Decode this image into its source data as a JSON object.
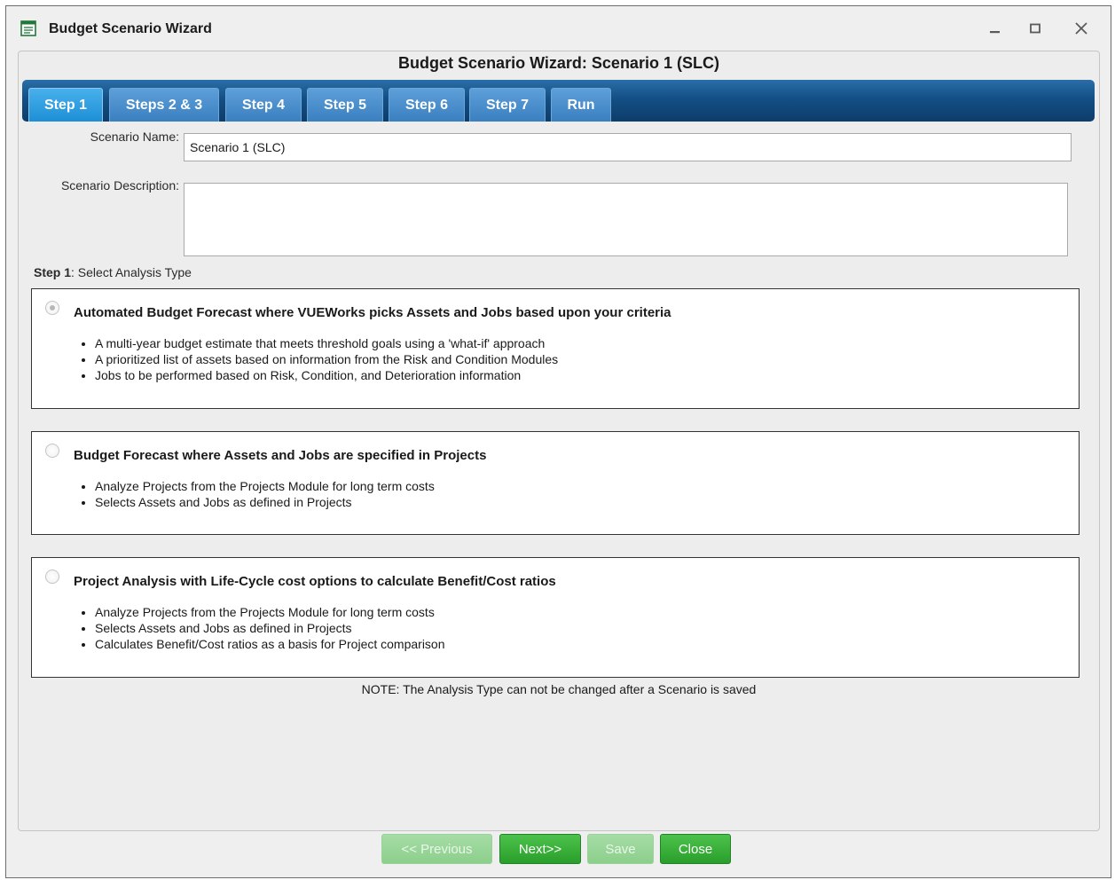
{
  "window": {
    "title": "Budget Scenario Wizard"
  },
  "panel": {
    "title": "Budget Scenario Wizard: Scenario 1 (SLC)"
  },
  "tabs": [
    {
      "label": "Step 1",
      "active": true
    },
    {
      "label": "Steps 2 & 3",
      "active": false
    },
    {
      "label": "Step 4",
      "active": false
    },
    {
      "label": "Step 5",
      "active": false
    },
    {
      "label": "Step 6",
      "active": false
    },
    {
      "label": "Step 7",
      "active": false
    },
    {
      "label": "Run",
      "active": false
    }
  ],
  "form": {
    "name_label": "Scenario Name:",
    "name_value": "Scenario 1 (SLC)",
    "description_label": "Scenario Description:",
    "description_value": ""
  },
  "step": {
    "prefix": "Step 1",
    "text": ": Select Analysis Type"
  },
  "options": [
    {
      "heading": "Automated Budget Forecast where VUEWorks picks Assets and Jobs based upon your criteria",
      "selected": true,
      "bullets": [
        "A multi-year budget estimate that meets threshold goals using a 'what-if' approach",
        "A prioritized list of assets based on information from the Risk and Condition Modules",
        "Jobs to be performed based on Risk, Condition, and Deterioration information"
      ]
    },
    {
      "heading": "Budget Forecast where Assets and Jobs are specified in Projects",
      "selected": false,
      "bullets": [
        "Analyze Projects from the Projects Module for long term costs",
        "Selects Assets and Jobs as defined in Projects"
      ]
    },
    {
      "heading": "Project Analysis with Life-Cycle cost options to calculate Benefit/Cost ratios",
      "selected": false,
      "bullets": [
        "Analyze Projects from the Projects Module for long term costs",
        "Selects Assets and Jobs as defined in Projects",
        "Calculates Benefit/Cost ratios as a basis for Project comparison"
      ]
    }
  ],
  "note": "NOTE: The Analysis Type can not be changed after a Scenario is saved",
  "buttons": {
    "previous": {
      "label": "<< Previous",
      "enabled": false
    },
    "next": {
      "label": "Next>>",
      "enabled": true
    },
    "save": {
      "label": "Save",
      "enabled": false
    },
    "close": {
      "label": "Close",
      "enabled": true
    }
  },
  "colors": {
    "tab_bar": "#134f85",
    "tab": "#3a7fc0",
    "tab_active": "#1d8fd6",
    "button_enabled": "#2a9e2a",
    "button_disabled": "#8ccf8c"
  }
}
